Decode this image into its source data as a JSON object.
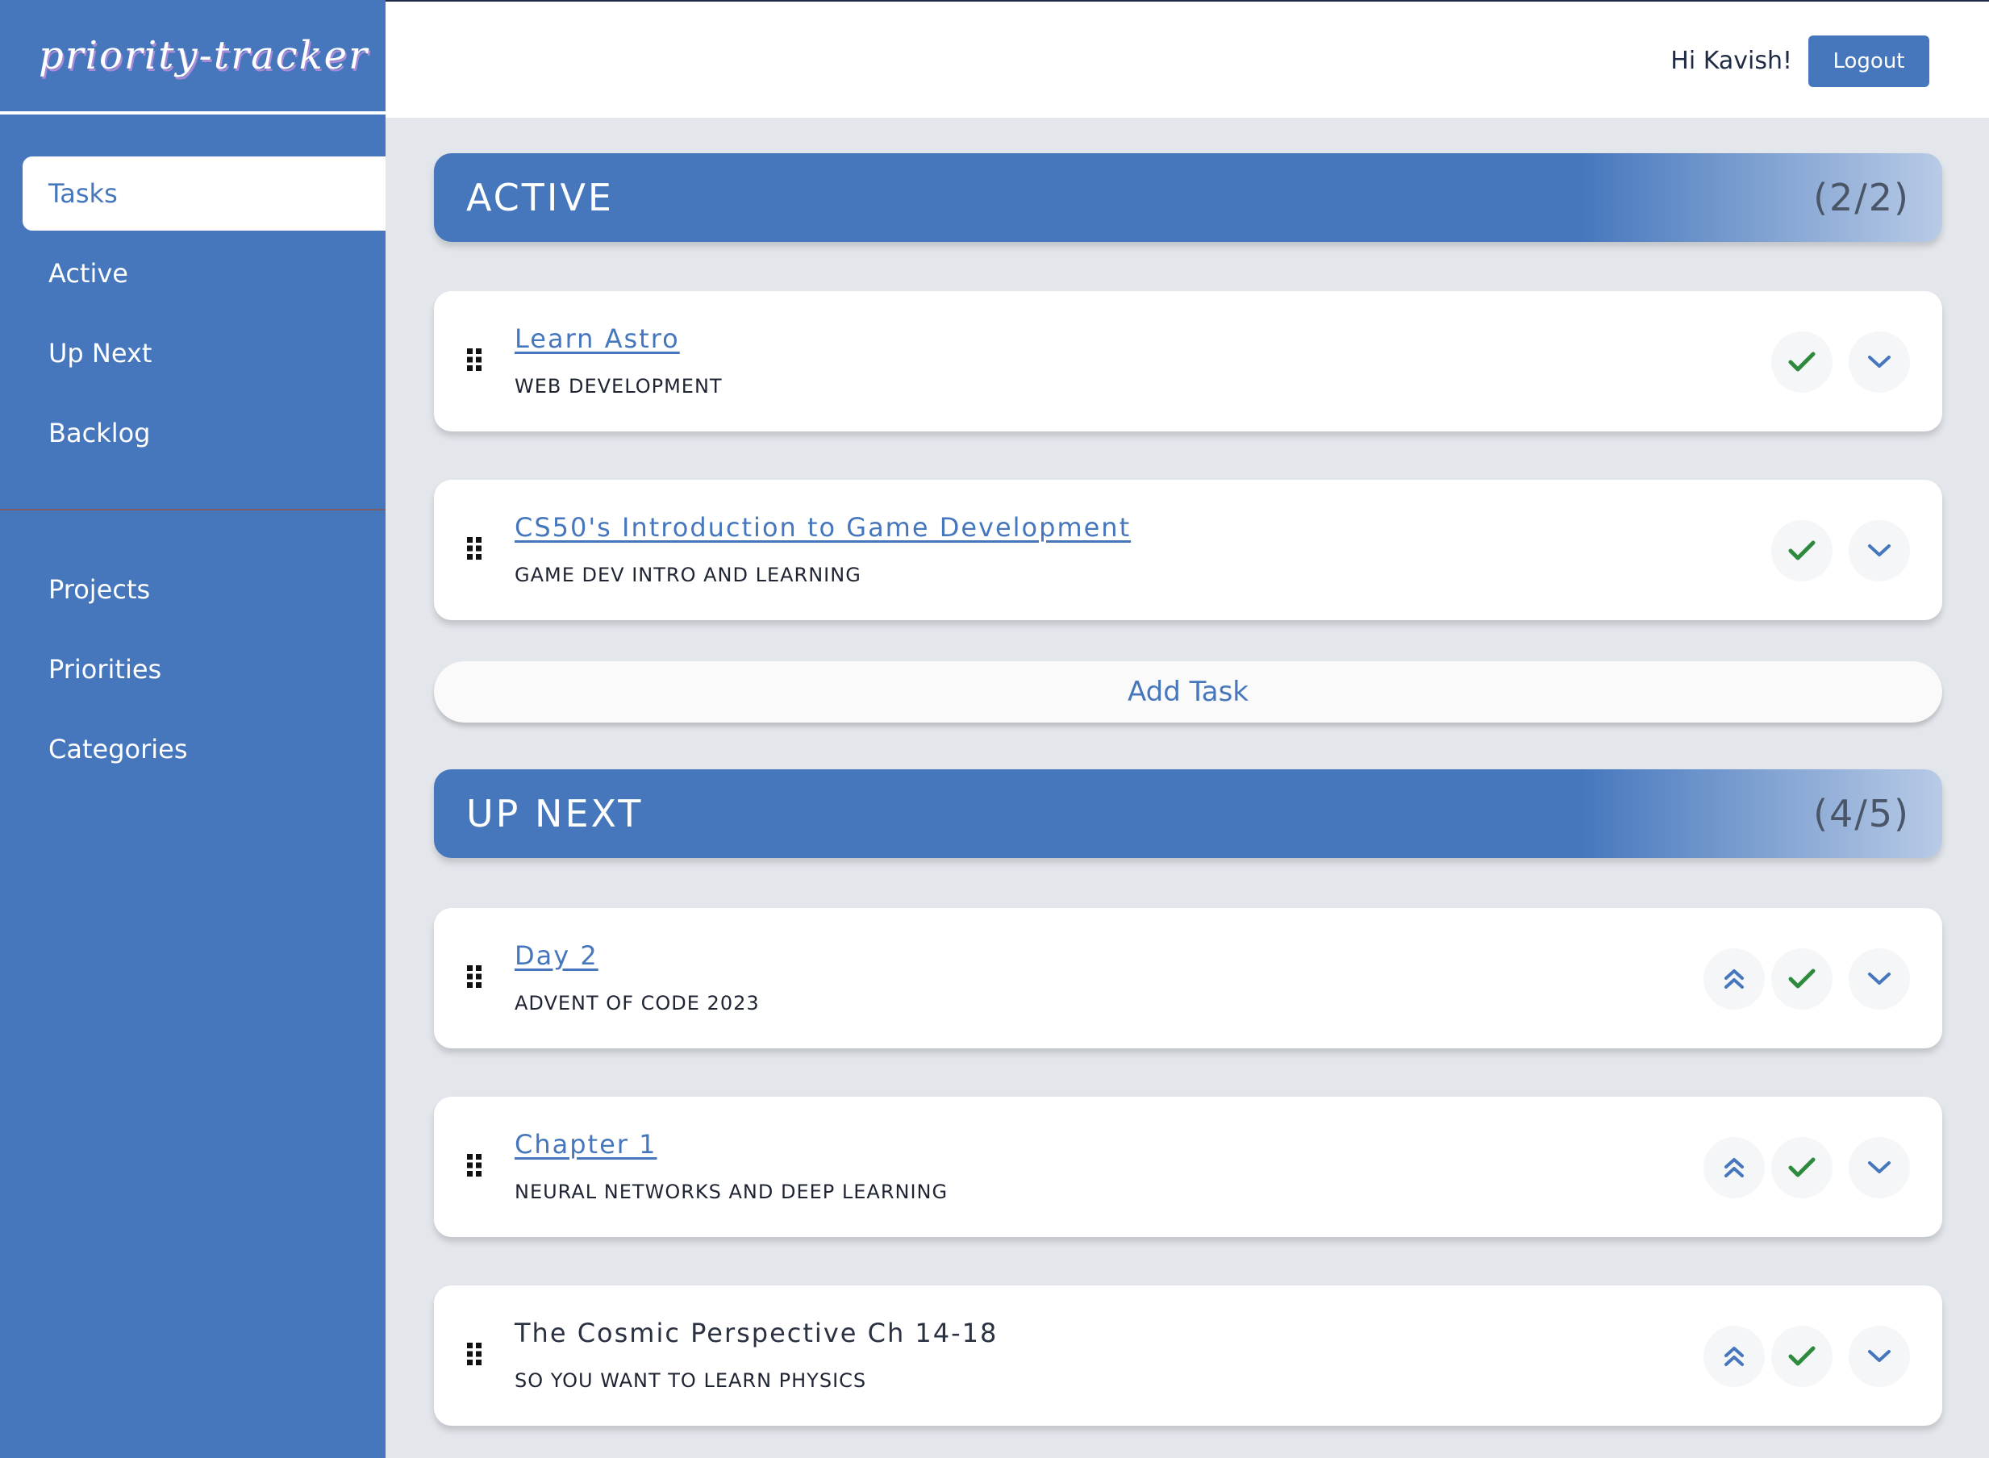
{
  "app": {
    "logo_text": "priority-tracker"
  },
  "sidebar": {
    "items": [
      {
        "label": "Tasks"
      },
      {
        "label": "Active"
      },
      {
        "label": "Up Next"
      },
      {
        "label": "Backlog"
      }
    ],
    "items_secondary": [
      {
        "label": "Projects"
      },
      {
        "label": "Priorities"
      },
      {
        "label": "Categories"
      }
    ]
  },
  "header": {
    "greeting": "Hi Kavish!",
    "logout_label": "Logout"
  },
  "sections": {
    "active": {
      "title": "ACTIVE",
      "count": "(2/2)",
      "tasks": [
        {
          "title": "Learn Astro",
          "subtitle": "WEB DEVELOPMENT"
        },
        {
          "title": "CS50's Introduction to Game Development",
          "subtitle": "GAME DEV INTRO AND LEARNING"
        }
      ],
      "add_task_label": "Add Task"
    },
    "up_next": {
      "title": "UP NEXT",
      "count": "(4/5)",
      "tasks": [
        {
          "title": "Day 2",
          "subtitle": "ADVENT OF CODE 2023"
        },
        {
          "title": "Chapter 1",
          "subtitle": "NEURAL NETWORKS AND DEEP LEARNING"
        },
        {
          "title": "The Cosmic Perspective Ch 14-18",
          "subtitle": "SO YOU WANT TO LEARN PHYSICS"
        }
      ]
    }
  },
  "colors": {
    "primary": "#4677bd",
    "check_green": "#2e8b3e",
    "background": "#e3e7ec"
  },
  "icons": {
    "drag": "drag-handle-icon",
    "complete": "checkmark-icon",
    "expand": "chevron-down-icon",
    "promote": "double-chevron-up-icon"
  }
}
